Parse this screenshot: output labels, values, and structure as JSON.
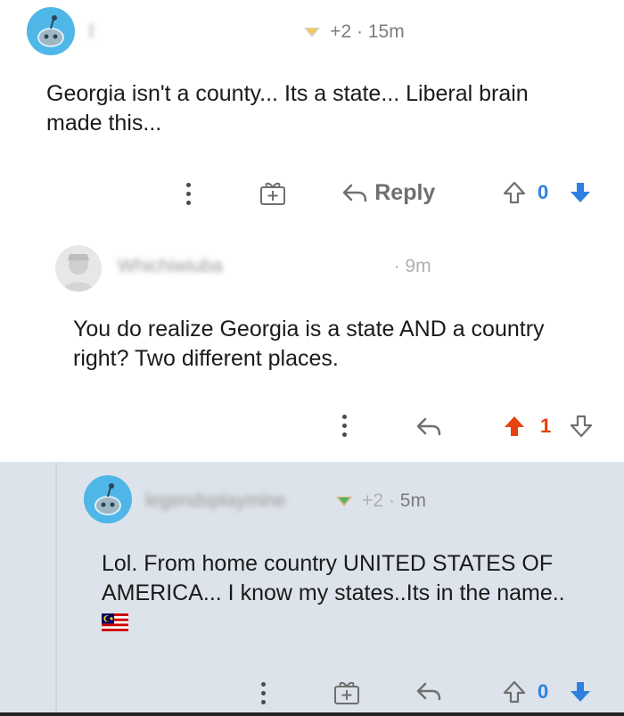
{
  "colors": {
    "avatar_blue": "#4fb6e8",
    "upvote_active": "#e8400e",
    "downvote_active": "#2f7fe0",
    "highlight_bg": "#dde3ea"
  },
  "comments": [
    {
      "username": "l",
      "award_count": "+2",
      "separator": "·",
      "time": "15m",
      "body": "Georgia isn't a county... Its a state... Liberal brain made this...",
      "reply_label": "Reply",
      "vote_count": "0",
      "upvoted": false,
      "downvoted": true
    },
    {
      "username": "Whichiwiuba",
      "separator": "·",
      "time": "9m",
      "body": "You do realize Georgia is a state AND a country right? Two different places.",
      "vote_count": "1",
      "upvoted": true,
      "downvoted": false
    },
    {
      "username": "legendsplaymine",
      "award_count": "+2",
      "separator": "·",
      "time": "5m",
      "body": "Lol. From home country UNITED STATES OF AMERICA... I know my states..Its in the name..",
      "flag_icon": "malaysia-flag-icon",
      "vote_count": "0",
      "upvoted": false,
      "downvoted": true
    }
  ]
}
